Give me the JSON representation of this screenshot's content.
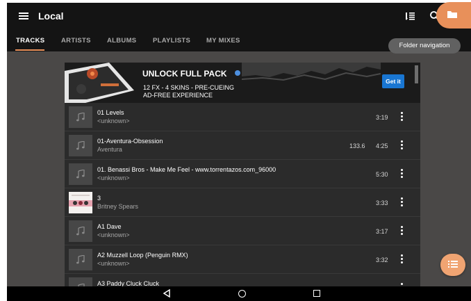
{
  "app": {
    "title": "Local",
    "menu_icon": "menu-icon",
    "sort_icon": "sort-list-icon",
    "search_icon": "search-icon",
    "folder_icon": "folder-icon",
    "accent_color": "#e8905a"
  },
  "tabs": [
    {
      "label": "TRACKS",
      "active": true
    },
    {
      "label": "ARTISTS",
      "active": false
    },
    {
      "label": "ALBUMS",
      "active": false
    },
    {
      "label": "PLAYLISTS",
      "active": false
    },
    {
      "label": "MY MIXES",
      "active": false
    }
  ],
  "tooltip": {
    "text": "Folder navigation"
  },
  "banner": {
    "title": "UNLOCK FULL PACK",
    "line1": "12 FX - 4 SKINS - PRE-CUEING",
    "line2": "AD-FREE EXPERIENCE",
    "cta": "Get it",
    "cta_color": "#1976d2"
  },
  "tracks": [
    {
      "title": "01 Levels",
      "artist": "<unknown>",
      "bpm": "",
      "duration": "3:19",
      "thumb": "music-note-icon"
    },
    {
      "title": "01-Aventura-Obsession",
      "artist": "Aventura",
      "bpm": "133.6",
      "duration": "4:25",
      "thumb": "music-note-icon"
    },
    {
      "title": "01. Benassi Bros - Make Me Feel - www.torrentazos.com_96000",
      "artist": "<unknown>",
      "bpm": "",
      "duration": "5:30",
      "thumb": "music-note-icon"
    },
    {
      "title": "3",
      "artist": "Britney Spears",
      "bpm": "",
      "duration": "3:33",
      "thumb": "album-art"
    },
    {
      "title": "A1 Dave",
      "artist": "<unknown>",
      "bpm": "",
      "duration": "3:17",
      "thumb": "music-note-icon"
    },
    {
      "title": "A2 Muzzell Loop (Penguin RMX)",
      "artist": "<unknown>",
      "bpm": "",
      "duration": "3:32",
      "thumb": "music-note-icon"
    },
    {
      "title": "A3 Paddy Cluck Cluck",
      "artist": "",
      "bpm": "",
      "duration": "",
      "thumb": "music-note-icon"
    }
  ],
  "fab": {
    "icon": "queue-list-icon"
  },
  "navbar": {
    "back_icon": "back-icon",
    "home_icon": "home-icon",
    "recents_icon": "recents-icon"
  }
}
